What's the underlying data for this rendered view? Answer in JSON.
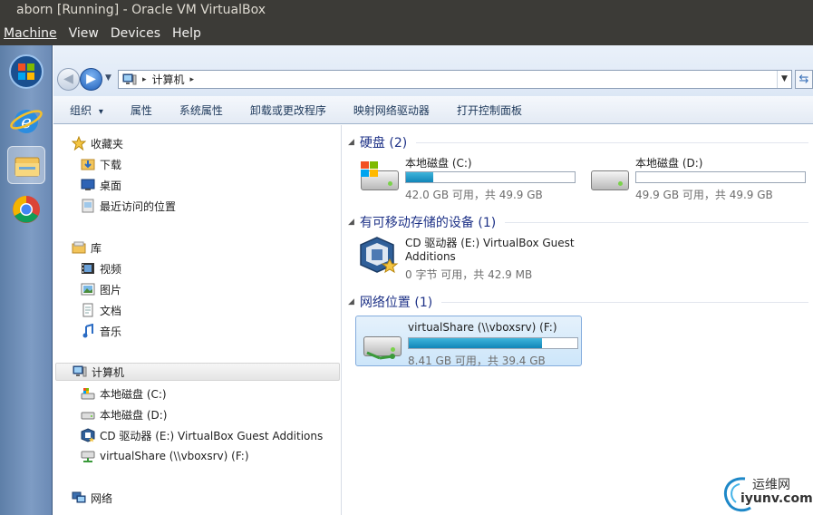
{
  "window": {
    "title": "aborn [Running] - Oracle VM VirtualBox"
  },
  "vbox_menu": [
    "Machine",
    "View",
    "Devices",
    "Help"
  ],
  "taskbar": {
    "icons": [
      "windows-start-orb-icon",
      "internet-explorer-icon",
      "explorer-folder-icon",
      "chrome-icon"
    ]
  },
  "address": {
    "path": "计算机",
    "separator": "▸"
  },
  "commands": {
    "organize": "组织",
    "organize_arrow": "▾",
    "properties": "属性",
    "system_properties": "系统属性",
    "uninstall": "卸载或更改程序",
    "map_drive": "映射网络驱动器",
    "control_panel": "打开控制面板"
  },
  "nav": {
    "favorites": "收藏夹",
    "downloads": "下载",
    "desktop": "桌面",
    "recent": "最近访问的位置",
    "libraries": "库",
    "videos": "视频",
    "pictures": "图片",
    "documents": "文档",
    "music": "音乐",
    "computer": "计算机",
    "drive_c": "本地磁盘 (C:)",
    "drive_d": "本地磁盘 (D:)",
    "drive_e": "CD 驱动器 (E:) VirtualBox Guest Additions",
    "drive_f": "virtualShare (\\\\vboxsrv) (F:)",
    "network": "网络"
  },
  "groups": {
    "hdd": "硬盘 (2)",
    "removable": "有可移动存储的设备 (1)",
    "network": "网络位置 (1)"
  },
  "drives": {
    "c": {
      "name": "本地磁盘 (C:)",
      "info": "42.0 GB 可用，共 49.9 GB",
      "used_fraction": 0.16
    },
    "d": {
      "name": "本地磁盘 (D:)",
      "info": "49.9 GB 可用，共 49.9 GB",
      "used_fraction": 0.0
    },
    "e": {
      "name_line1": "CD 驱动器 (E:) VirtualBox Guest",
      "name_line2": "Additions",
      "info": "0 字节 可用，共 42.9 MB"
    },
    "f": {
      "name": "virtualShare (\\\\vboxsrv) (F:)",
      "info": "8.41 GB 可用，共 39.4 GB",
      "used_fraction": 0.79
    }
  },
  "watermark": {
    "line1": "运维网",
    "line2": "iyunv.com"
  }
}
